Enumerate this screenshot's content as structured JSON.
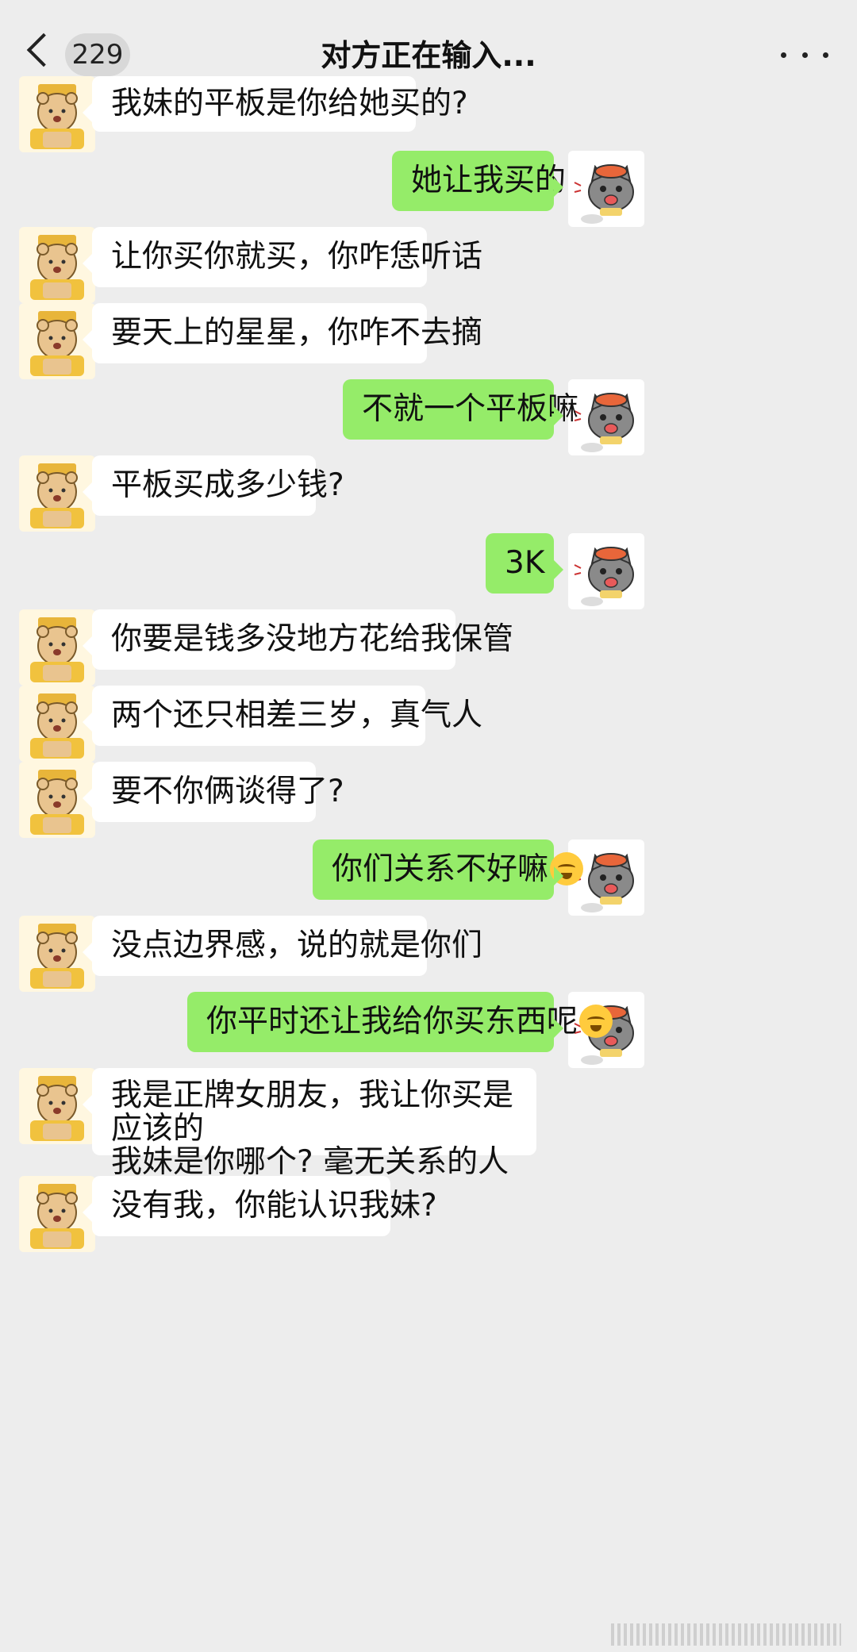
{
  "header": {
    "back_count": "229",
    "title": "对方正在输入..."
  },
  "messages": [
    {
      "side": "left",
      "text": "我妹的平板是你给她买的?"
    },
    {
      "side": "right",
      "text": "她让我买的"
    },
    {
      "side": "left",
      "text": "让你买你就买，你咋恁听话"
    },
    {
      "side": "left",
      "text": "要天上的星星，你咋不去摘"
    },
    {
      "side": "right",
      "text": "不就一个平板嘛"
    },
    {
      "side": "left",
      "text": "平板买成多少钱?"
    },
    {
      "side": "right",
      "text": "3K"
    },
    {
      "side": "left",
      "text": "你要是钱多没地方花给我保管"
    },
    {
      "side": "left",
      "text": "两个还只相差三岁，真气人"
    },
    {
      "side": "left",
      "text": "要不你俩谈得了?"
    },
    {
      "side": "right",
      "text": "你们关系不好嘛",
      "emoji": "laughing-tears"
    },
    {
      "side": "left",
      "text": "没点边界感，说的就是你们"
    },
    {
      "side": "right",
      "text": "你平时还让我给你买东西呢",
      "emoji": "laughing-tears"
    },
    {
      "side": "left",
      "text": "我是正牌女朋友，我让你买是应该的",
      "text2": "我妹是你哪个? 毫无关系的人"
    },
    {
      "side": "left",
      "text": "没有我，你能认识我妹?"
    }
  ],
  "colors": {
    "background": "#ededed",
    "bubble_left": "#ffffff",
    "bubble_right": "#95ec69"
  }
}
